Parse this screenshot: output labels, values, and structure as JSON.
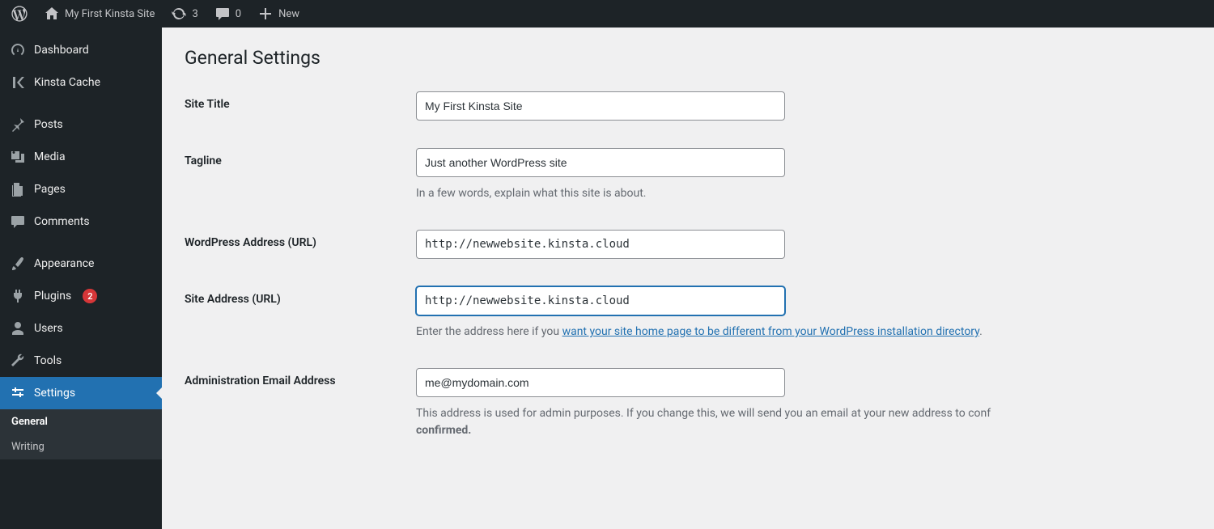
{
  "adminbar": {
    "site_name": "My First Kinsta Site",
    "updates_count": "3",
    "comments_count": "0",
    "new_label": "New"
  },
  "sidebar": {
    "items": [
      {
        "name": "dashboard",
        "label": "Dashboard"
      },
      {
        "name": "kinsta-cache",
        "label": "Kinsta Cache"
      },
      {
        "name": "posts",
        "label": "Posts"
      },
      {
        "name": "media",
        "label": "Media"
      },
      {
        "name": "pages",
        "label": "Pages"
      },
      {
        "name": "comments",
        "label": "Comments"
      },
      {
        "name": "appearance",
        "label": "Appearance"
      },
      {
        "name": "plugins",
        "label": "Plugins",
        "badge": "2"
      },
      {
        "name": "users",
        "label": "Users"
      },
      {
        "name": "tools",
        "label": "Tools"
      },
      {
        "name": "settings",
        "label": "Settings"
      }
    ],
    "submenu": [
      {
        "label": "General",
        "active": true
      },
      {
        "label": "Writing",
        "active": false
      }
    ]
  },
  "page": {
    "heading": "General Settings",
    "fields": {
      "site_title": {
        "label": "Site Title",
        "value": "My First Kinsta Site"
      },
      "tagline": {
        "label": "Tagline",
        "value": "Just another WordPress site",
        "desc": "In a few words, explain what this site is about."
      },
      "wp_url": {
        "label": "WordPress Address (URL)",
        "value": "http://newwebsite.kinsta.cloud"
      },
      "site_url": {
        "label": "Site Address (URL)",
        "value": "http://newwebsite.kinsta.cloud",
        "desc_pre": "Enter the address here if you ",
        "desc_link": "want your site home page to be different from your WordPress installation directory",
        "desc_post": "."
      },
      "admin_email": {
        "label": "Administration Email Address",
        "value": "me@mydomain.com",
        "desc_pre": "This address is used for admin purposes. If you change this, we will send you an email at your new address to conf",
        "desc_bold": "confirmed."
      }
    }
  }
}
